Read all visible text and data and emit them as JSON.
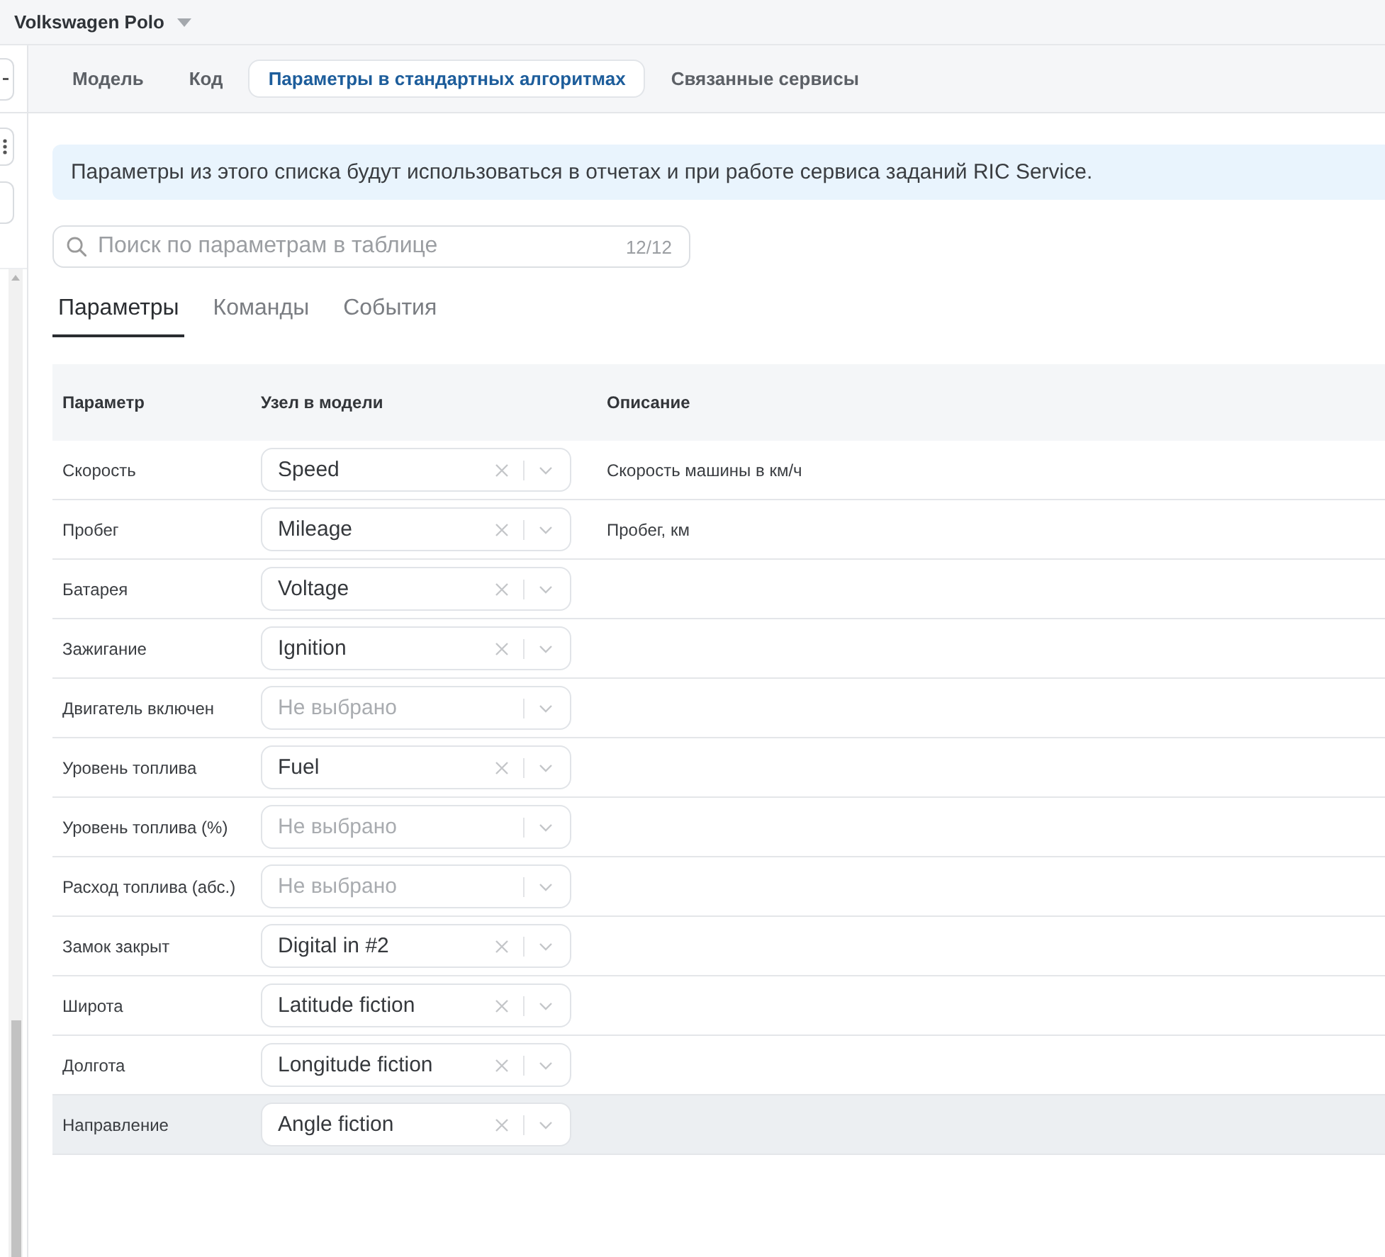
{
  "header": {
    "title": "Volkswagen Polo"
  },
  "tabs": [
    {
      "label": "Модель",
      "selected": false
    },
    {
      "label": "Код",
      "selected": false
    },
    {
      "label": "Параметры в стандартных алгоритмах",
      "selected": true
    },
    {
      "label": "Связанные сервисы",
      "selected": false
    }
  ],
  "info_banner": {
    "text": "Параметры из этого списка будут использоваться в отчетах и при работе сервиса заданий RIC Service."
  },
  "search": {
    "placeholder": "Поиск по параметрам в таблице",
    "count": "12/12"
  },
  "subtabs": [
    {
      "label": "Параметры",
      "selected": true
    },
    {
      "label": "Команды",
      "selected": false
    },
    {
      "label": "События",
      "selected": false
    }
  ],
  "table": {
    "columns": [
      "Параметр",
      "Узел в модели",
      "Описание"
    ],
    "rows": [
      {
        "parameter": "Скорость",
        "node": {
          "value": "Speed"
        },
        "description": "Скорость машины в км/ч",
        "highlighted": false
      },
      {
        "parameter": "Пробег",
        "node": {
          "value": "Mileage"
        },
        "description": "Пробег, км",
        "highlighted": false
      },
      {
        "parameter": "Батарея",
        "node": {
          "value": "Voltage"
        },
        "highlighted": false
      },
      {
        "parameter": "Зажигание",
        "node": {
          "value": "Ignition"
        },
        "highlighted": false
      },
      {
        "parameter": "Двигатель включен",
        "node": {
          "placeholder": "Не выбрано"
        },
        "highlighted": false
      },
      {
        "parameter": "Уровень топлива",
        "node": {
          "value": "Fuel"
        },
        "highlighted": false
      },
      {
        "parameter": "Уровень топлива (%)",
        "node": {
          "placeholder": "Не выбрано"
        },
        "highlighted": false
      },
      {
        "parameter": "Расход топлива (абс.)",
        "node": {
          "placeholder": "Не выбрано"
        },
        "highlighted": false
      },
      {
        "parameter": "Замок закрыт",
        "node": {
          "value": "Digital in #2"
        },
        "highlighted": false
      },
      {
        "parameter": "Широта",
        "node": {
          "value": "Latitude fiction"
        },
        "highlighted": false
      },
      {
        "parameter": "Долгота",
        "node": {
          "value": "Longitude fiction"
        },
        "highlighted": false
      },
      {
        "parameter": "Направление",
        "node": {
          "value": "Angle fiction"
        },
        "highlighted": true
      }
    ]
  }
}
